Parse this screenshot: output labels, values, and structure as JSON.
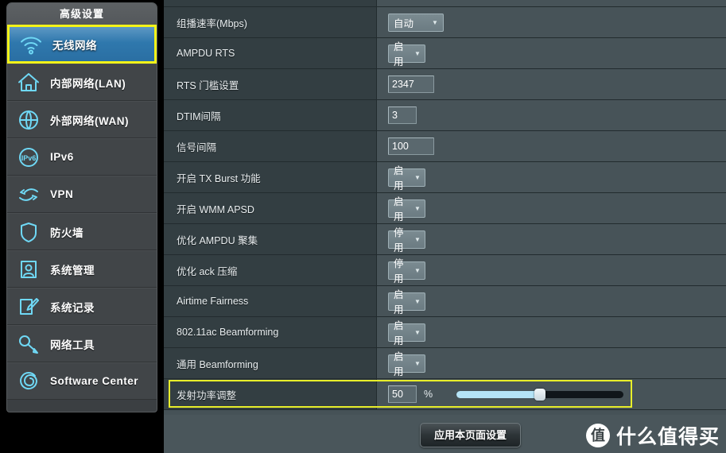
{
  "sidebar": {
    "header": "高级设置",
    "items": [
      {
        "label": "无线网络",
        "icon": "wifi-icon",
        "active": true
      },
      {
        "label": "内部网络(LAN)",
        "icon": "home-icon",
        "active": false
      },
      {
        "label": "外部网络(WAN)",
        "icon": "globe-icon",
        "active": false
      },
      {
        "label": "IPv6",
        "icon": "ipv6-icon",
        "active": false
      },
      {
        "label": "VPN",
        "icon": "vpn-icon",
        "active": false
      },
      {
        "label": "防火墙",
        "icon": "shield-icon",
        "active": false
      },
      {
        "label": "系统管理",
        "icon": "user-icon",
        "active": false
      },
      {
        "label": "系统记录",
        "icon": "log-pencil-icon",
        "active": false
      },
      {
        "label": "网络工具",
        "icon": "wrench-icon",
        "active": false
      },
      {
        "label": "Software Center",
        "icon": "spiral-icon",
        "active": false
      }
    ]
  },
  "settings": {
    "rows": [
      {
        "label": "",
        "control": "partial",
        "value": ""
      },
      {
        "label": "组播速率(Mbps)",
        "control": "select-wide",
        "value": "自动"
      },
      {
        "label": "AMPDU RTS",
        "control": "select-narrow",
        "value": "启用"
      },
      {
        "label": "RTS 门槛设置",
        "control": "text-wide",
        "value": "2347"
      },
      {
        "label": "DTIM间隔",
        "control": "text-narrow",
        "value": "3"
      },
      {
        "label": "信号间隔",
        "control": "text-wide",
        "value": "100"
      },
      {
        "label": "开启 TX Burst 功能",
        "control": "select-narrow",
        "value": "启用"
      },
      {
        "label": "开启 WMM APSD",
        "control": "select-narrow",
        "value": "启用"
      },
      {
        "label": "优化 AMPDU 聚集",
        "control": "select-narrow",
        "value": "停用"
      },
      {
        "label": "优化 ack 压缩",
        "control": "select-narrow",
        "value": "停用"
      },
      {
        "label": "Airtime Fairness",
        "control": "select-narrow",
        "value": "启用"
      },
      {
        "label": "802.11ac Beamforming",
        "control": "select-narrow",
        "value": "启用"
      },
      {
        "label": "通用 Beamforming",
        "control": "select-narrow",
        "value": "启用"
      },
      {
        "label": "发射功率调整",
        "control": "slider",
        "value": "50",
        "unit": "%",
        "slider_percent": 50,
        "highlighted": true
      }
    ]
  },
  "footer": {
    "apply_label": "应用本页面设置",
    "watermark_badge": "值",
    "watermark_text": "什么值得买"
  },
  "colors": {
    "accent_yellow": "#e8ee2a",
    "active_blue": "#2f78ad",
    "panel_bg": "#465257",
    "label_bg": "#333e42",
    "slider_fill": "#b5e4f7"
  }
}
